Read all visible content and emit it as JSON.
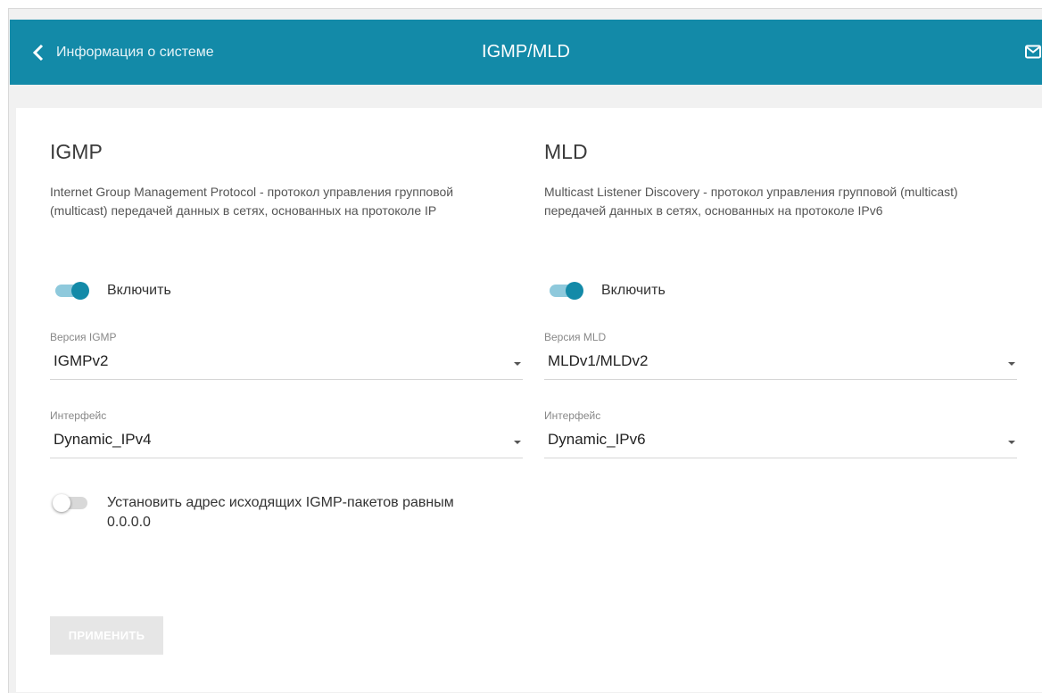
{
  "header": {
    "back_label": "Информация о системе",
    "title": "IGMP/MLD",
    "accent_color": "#138aa8",
    "icons": {
      "back": "chevron-left-icon",
      "mail": "mail-icon"
    }
  },
  "igmp": {
    "title": "IGMP",
    "description": "Internet Group Management Protocol - протокол управления групповой (multicast) передачей данных в сетях, основанных на протоколе IP",
    "enable_label": "Включить",
    "enabled": true,
    "version_label": "Версия IGMP",
    "version_value": "IGMPv2",
    "interface_label": "Интерфейс",
    "interface_value": "Dynamic_IPv4",
    "zero_source_label": "Установить адрес исходящих IGMP-пакетов равным 0.0.0.0",
    "zero_source_enabled": false
  },
  "mld": {
    "title": "MLD",
    "description": "Multicast Listener Discovery - протокол управления групповой (multicast) передачей данных в сетях, основанных на протоколе IPv6",
    "enable_label": "Включить",
    "enabled": true,
    "version_label": "Версия MLD",
    "version_value": "MLDv1/MLDv2",
    "interface_label": "Интерфейс",
    "interface_value": "Dynamic_IPv6"
  },
  "actions": {
    "apply_label": "ПРИМЕНИТЬ",
    "apply_enabled": false
  }
}
